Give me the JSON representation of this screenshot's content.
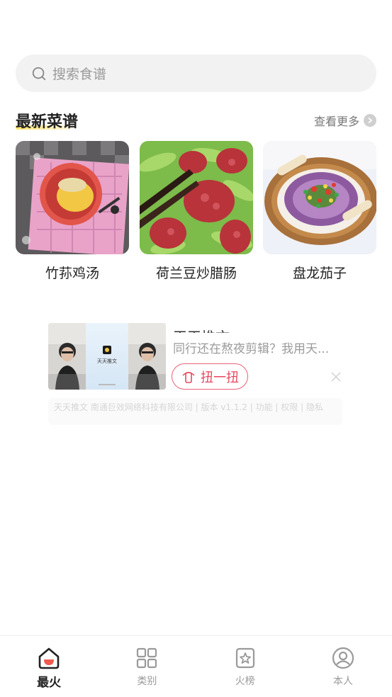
{
  "search": {
    "placeholder": "搜索食谱",
    "icon": "search-icon"
  },
  "latest": {
    "title": "最新菜谱",
    "more_label": "查看更多",
    "recipes": [
      {
        "name": "竹荪鸡汤"
      },
      {
        "name": "荷兰豆炒腊肠"
      },
      {
        "name": "盘龙茄子"
      }
    ]
  },
  "ad": {
    "title": "天天推文",
    "thumb_text": "天天推文",
    "description": "同行还在熬夜剪辑？我用天...",
    "button_label": "扭一扭"
  },
  "footer": {
    "text": "天天推文 南通巨效网络科技有限公司 | 版本 v1.1.2 | 功能 | 权限 | 隐私"
  },
  "tabs": [
    {
      "label": "最火",
      "icon": "home-icon",
      "active": true
    },
    {
      "label": "类别",
      "icon": "grid-icon",
      "active": false
    },
    {
      "label": "火榜",
      "icon": "star-badge-icon",
      "active": false
    },
    {
      "label": "本人",
      "icon": "user-icon",
      "active": false
    }
  ],
  "colors": {
    "accent": "#e8475f",
    "highlight": "#ffe36b"
  }
}
